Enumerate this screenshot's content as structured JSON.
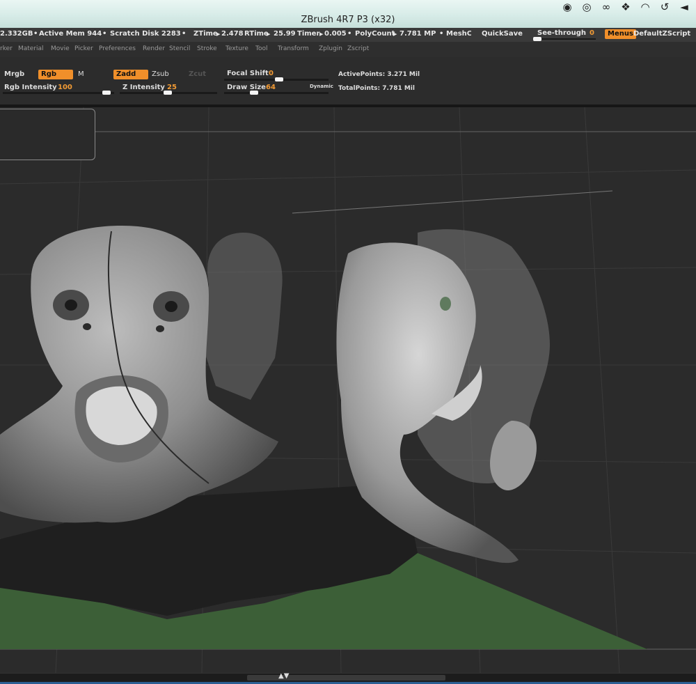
{
  "window": {
    "title": "ZBrush 4R7 P3 (x32)"
  },
  "menubar_icons": [
    "nvidia-icon",
    "sync-icon",
    "creative-cloud-icon",
    "dropbox-icon",
    "wifi-icon",
    "time-machine-icon",
    "volume-icon"
  ],
  "status": {
    "mem": "2.332GB",
    "active_mem": "Active Mem 944",
    "scratch": "Scratch Disk 2283",
    "ztime": "ZTime",
    "ztime_val": "2.478",
    "rtime": "RTime",
    "rtime_val": "25.99",
    "timer": "Timer",
    "timer_val": "0.005",
    "polycount": "PolyCount",
    "polycount_val": "7.781 MP",
    "meshcount": "MeshCo",
    "quicksave": "QuickSave",
    "seethrough": "See-through",
    "seethrough_val": "0",
    "menus": "Menus",
    "script": "DefaultZScript"
  },
  "menus": [
    "rker",
    "Material",
    "Movie",
    "Picker",
    "Preferences",
    "Render",
    "Stencil",
    "Stroke",
    "Texture",
    "Tool",
    "Transform",
    "Zplugin",
    "Zscript"
  ],
  "tools": {
    "mrgb": "Mrgb",
    "rgb": "Rgb",
    "m": "M",
    "zadd": "Zadd",
    "zsub": "Zsub",
    "zcut": "Zcut",
    "rgb_intensity": "Rgb Intensity",
    "rgb_intensity_val": "100",
    "z_intensity": "Z Intensity",
    "z_intensity_val": "25",
    "focal_shift": "Focal Shift",
    "focal_shift_val": "0",
    "draw_size": "Draw Size",
    "draw_size_val": "64",
    "dynamic": "Dynamic",
    "active_points": "ActivePoints: 3.271 Mil",
    "total_points": "TotalPoints: 7.781 Mil"
  },
  "colors": {
    "accent": "#f08f2a",
    "floor": "#3c5f37",
    "canvas": "#2b2b2b"
  }
}
